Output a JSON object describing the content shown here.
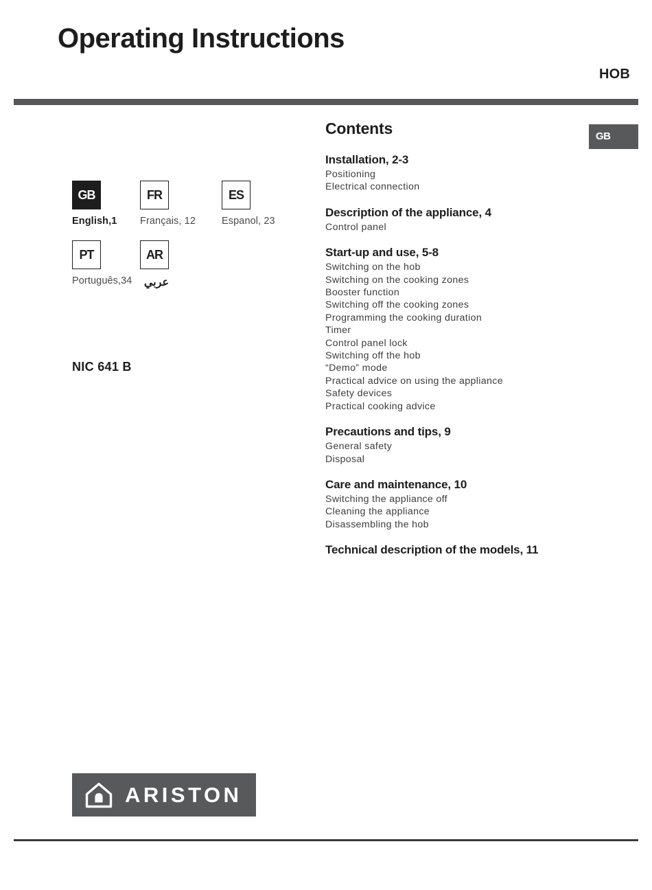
{
  "header": {
    "title": "Operating Instructions",
    "appliance_type": "HOB"
  },
  "language_tab": {
    "code": "GB"
  },
  "languages": [
    [
      {
        "code": "GB",
        "caption": "English,1",
        "current": true
      },
      {
        "code": "FR",
        "caption": "Français, 12",
        "current": false
      },
      {
        "code": "ES",
        "caption": "Espanol, 23",
        "current": false
      }
    ],
    [
      {
        "code": "PT",
        "caption": "Português,34",
        "current": false
      },
      {
        "code": "AR",
        "caption": "عربي",
        "current": false
      }
    ]
  ],
  "model": {
    "number": "NIC 641 B"
  },
  "contents": {
    "title": "Contents",
    "sections": [
      {
        "heading": "Installation, 2-3",
        "items": [
          "Positioning",
          "Electrical connection"
        ]
      },
      {
        "heading": "Description of the appliance, 4",
        "items": [
          "Control panel"
        ]
      },
      {
        "heading": "Start-up and use, 5-8",
        "items": [
          "Switching on the hob",
          "Switching on the cooking zones",
          "Booster function",
          "Switching off the cooking zones",
          "Programming the cooking duration",
          "Timer",
          "Control panel lock",
          "Switching off the hob",
          "“Demo” mode",
          "Practical advice on using the appliance",
          "Safety devices",
          "Practical cooking advice"
        ]
      },
      {
        "heading": "Precautions and tips, 9",
        "items": [
          "General safety",
          "Disposal"
        ]
      },
      {
        "heading": "Care and maintenance, 10",
        "items": [
          "Switching the appliance off",
          "Cleaning the appliance",
          "Disassembling the hob"
        ]
      },
      {
        "heading": "Technical description of the models, 11",
        "items": []
      }
    ]
  },
  "brand": {
    "name": "ARISTON"
  },
  "colors": {
    "bar_gray": "#565659",
    "logo_gray": "#58595b",
    "text_dark": "#1d1d1d",
    "text_body": "#3d3d3d"
  }
}
